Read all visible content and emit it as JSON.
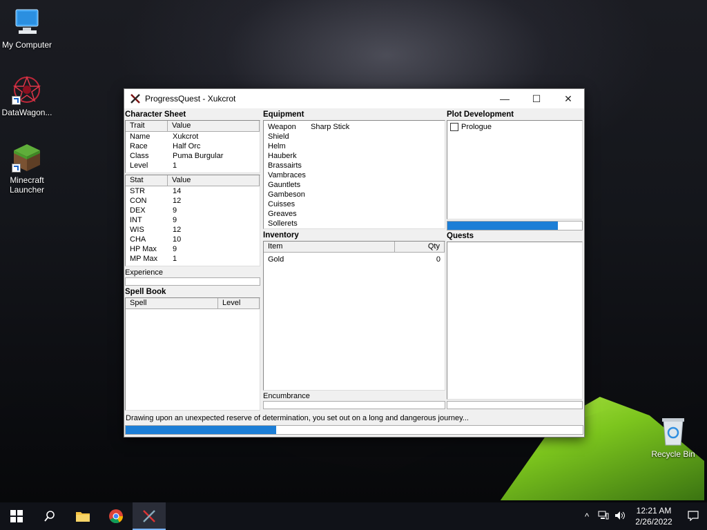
{
  "desktop": {
    "icons": [
      {
        "label": "My Computer"
      },
      {
        "label": "DataWagon..."
      },
      {
        "label": "Minecraft\nLauncher"
      },
      {
        "label": "Recycle Bin"
      }
    ]
  },
  "window": {
    "title": "ProgressQuest - Xukcrot",
    "minimize": "—",
    "maximize": "☐",
    "close": "✕"
  },
  "character_sheet": {
    "heading": "Character Sheet",
    "traits_header": [
      "Trait",
      "Value"
    ],
    "traits": [
      {
        "trait": "Name",
        "value": "Xukcrot"
      },
      {
        "trait": "Race",
        "value": "Half Orc"
      },
      {
        "trait": "Class",
        "value": "Puma Burgular"
      },
      {
        "trait": "Level",
        "value": "1"
      }
    ],
    "stats_header": [
      "Stat",
      "Value"
    ],
    "stats": [
      {
        "stat": "STR",
        "value": "14"
      },
      {
        "stat": "CON",
        "value": "12"
      },
      {
        "stat": "DEX",
        "value": "9"
      },
      {
        "stat": "INT",
        "value": "9"
      },
      {
        "stat": "WIS",
        "value": "12"
      },
      {
        "stat": "CHA",
        "value": "10"
      },
      {
        "stat": "HP Max",
        "value": "9"
      },
      {
        "stat": "MP Max",
        "value": "1"
      }
    ],
    "experience_label": "Experience",
    "experience_progress": 0
  },
  "spell_book": {
    "heading": "Spell Book",
    "header": [
      "Spell",
      "Level"
    ]
  },
  "equipment": {
    "heading": "Equipment",
    "items": [
      {
        "slot": "Weapon",
        "item": "Sharp Stick"
      },
      {
        "slot": "Shield",
        "item": ""
      },
      {
        "slot": "Helm",
        "item": ""
      },
      {
        "slot": "Hauberk",
        "item": ""
      },
      {
        "slot": "Brassairts",
        "item": ""
      },
      {
        "slot": "Vambraces",
        "item": ""
      },
      {
        "slot": "Gauntlets",
        "item": ""
      },
      {
        "slot": "Gambeson",
        "item": ""
      },
      {
        "slot": "Cuisses",
        "item": ""
      },
      {
        "slot": "Greaves",
        "item": ""
      },
      {
        "slot": "Sollerets",
        "item": ""
      }
    ]
  },
  "inventory": {
    "heading": "Inventory",
    "header": [
      "Item",
      "Qty"
    ],
    "items": [
      {
        "item": "Gold",
        "qty": "0"
      }
    ],
    "encumbrance_label": "Encumbrance",
    "encumbrance_progress": 0
  },
  "plot": {
    "heading": "Plot Development",
    "acts": [
      {
        "label": "Prologue",
        "checked": false
      }
    ],
    "progress": 0.82
  },
  "quests": {
    "heading": "Quests",
    "progress": 0
  },
  "status": {
    "message": "Drawing upon an unexpected reserve of determination, you set out on a long and dangerous journey...",
    "progress": 0.33
  },
  "taskbar": {
    "time": "12:21 AM",
    "date": "2/26/2022"
  },
  "colors": {
    "progress": "#1c7ed6",
    "window_bg": "#f0f0f0"
  }
}
